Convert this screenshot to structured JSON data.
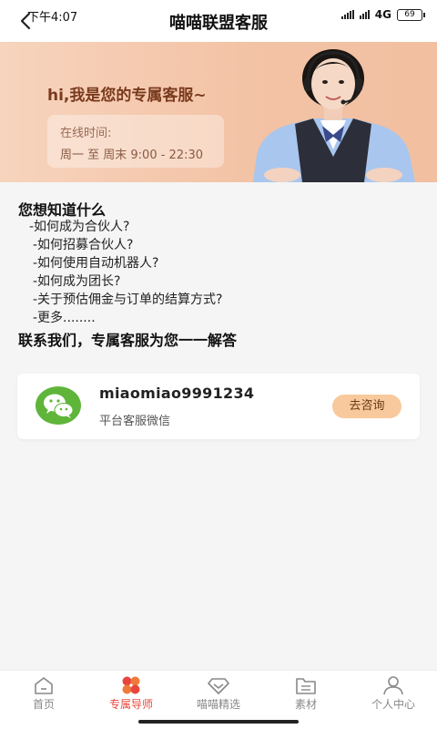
{
  "status_bar": {
    "time": "下午4:07",
    "network": "4G",
    "battery": "69"
  },
  "header": {
    "title": "喵喵联盟客服"
  },
  "banner": {
    "title": "hi,我是您的专属客服~",
    "hours_label": "在线时间:",
    "hours_value": "周一 至 周末 9:00 - 22:30"
  },
  "faq": {
    "heading": "您想知道什么",
    "items": [
      "-如何成为合伙人?",
      "-如何招募合伙人?",
      "-如何使用自动机器人?",
      "-如何成为团长?",
      "-关于预估佣金与订单的结算方式?",
      "-更多........"
    ],
    "footer": "联系我们，专属客服为您一一解答"
  },
  "contact_card": {
    "icon": "wechat-icon",
    "id": "miaomiao9991234",
    "subtitle": "平台客服微信",
    "button": "去咨询",
    "button_color": "#f8c99c"
  },
  "tabbar": {
    "active_color": "#e8453c",
    "items": [
      {
        "label": "首页",
        "icon": "home-icon"
      },
      {
        "label": "专属导师",
        "icon": "clover-icon",
        "active": true
      },
      {
        "label": "喵喵精选",
        "icon": "diamond-icon"
      },
      {
        "label": "素材",
        "icon": "folder-icon"
      },
      {
        "label": "个人中心",
        "icon": "person-icon"
      }
    ]
  }
}
